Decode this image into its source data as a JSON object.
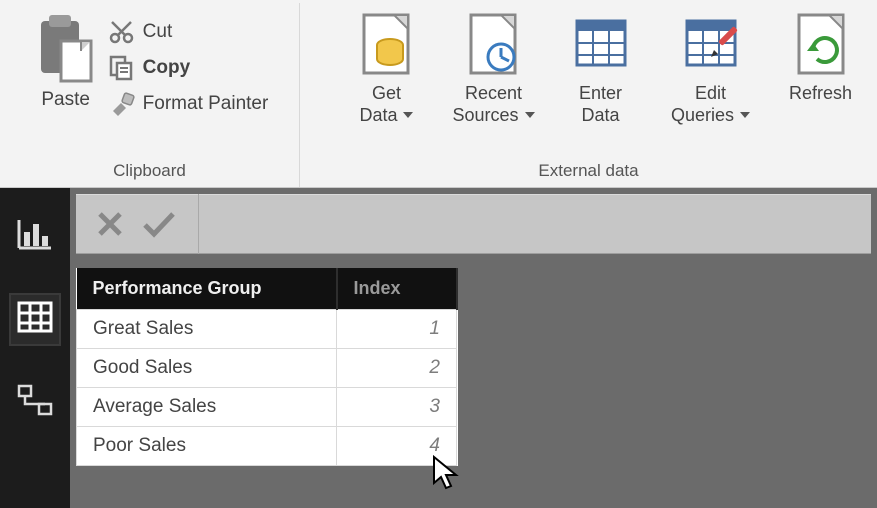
{
  "ribbon": {
    "clipboard": {
      "paste": "Paste",
      "cut": "Cut",
      "copy": "Copy",
      "format_painter": "Format Painter",
      "group_label": "Clipboard"
    },
    "external": {
      "get_data_l1": "Get",
      "get_data_l2": "Data",
      "recent_l1": "Recent",
      "recent_l2": "Sources",
      "enter_l1": "Enter",
      "enter_l2": "Data",
      "edit_l1": "Edit",
      "edit_l2": "Queries",
      "refresh": "Refresh",
      "group_label": "External data"
    }
  },
  "formula_bar": {
    "value": ""
  },
  "table": {
    "columns": {
      "c0": "Performance Group",
      "c1": "Index"
    },
    "rows": [
      {
        "name": "Great Sales",
        "index": "1"
      },
      {
        "name": "Good Sales",
        "index": "2"
      },
      {
        "name": "Average Sales",
        "index": "3"
      },
      {
        "name": "Poor Sales",
        "index": "4"
      }
    ]
  }
}
